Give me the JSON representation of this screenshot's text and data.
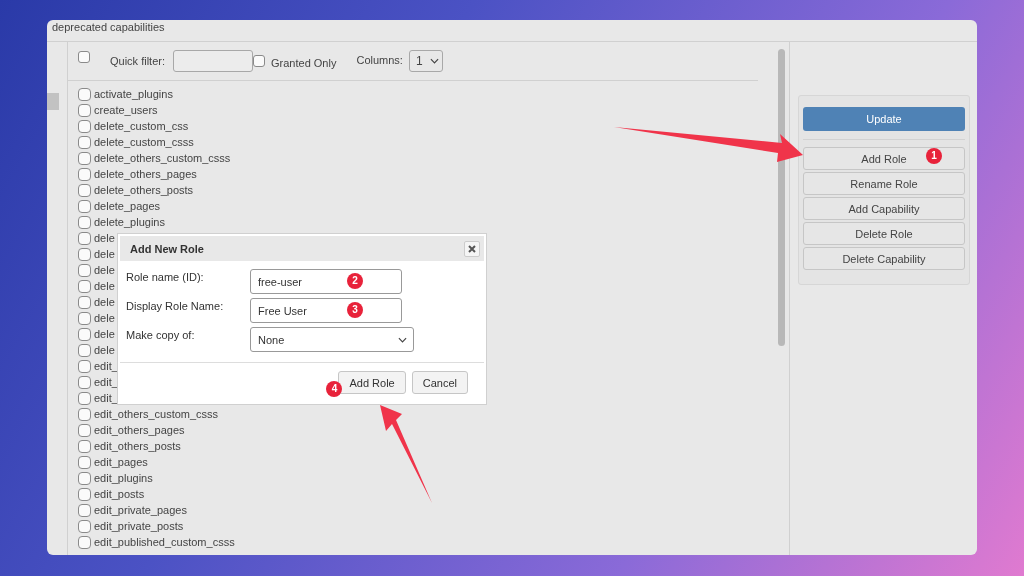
{
  "window": {
    "title": "deprecated capabilities"
  },
  "toolbar": {
    "select_all": {
      "checked": false
    },
    "quick_filter": {
      "label": "Quick filter:"
    },
    "granted_only": {
      "label": "Granted Only",
      "checked": false
    },
    "columns": {
      "label": "Columns:",
      "value": "1"
    }
  },
  "capabilities": [
    {
      "name": "activate_plugins",
      "checked": false
    },
    {
      "name": "create_users",
      "checked": false
    },
    {
      "name": "delete_custom_css",
      "checked": false
    },
    {
      "name": "delete_custom_csss",
      "checked": false
    },
    {
      "name": "delete_others_custom_csss",
      "checked": false
    },
    {
      "name": "delete_others_pages",
      "checked": false
    },
    {
      "name": "delete_others_posts",
      "checked": false
    },
    {
      "name": "delete_pages",
      "checked": false
    },
    {
      "name": "delete_plugins",
      "checked": false
    },
    {
      "name": "dele",
      "checked": false
    },
    {
      "name": "dele",
      "checked": false
    },
    {
      "name": "dele",
      "checked": false
    },
    {
      "name": "dele",
      "checked": false
    },
    {
      "name": "dele",
      "checked": false
    },
    {
      "name": "dele",
      "checked": false
    },
    {
      "name": "dele",
      "checked": false
    },
    {
      "name": "dele",
      "checked": false
    },
    {
      "name": "edit_",
      "checked": false
    },
    {
      "name": "edit_",
      "checked": false
    },
    {
      "name": "edit_",
      "checked": false
    },
    {
      "name": "edit_others_custom_csss",
      "checked": false
    },
    {
      "name": "edit_others_pages",
      "checked": false
    },
    {
      "name": "edit_others_posts",
      "checked": false
    },
    {
      "name": "edit_pages",
      "checked": false
    },
    {
      "name": "edit_plugins",
      "checked": false
    },
    {
      "name": "edit_posts",
      "checked": false
    },
    {
      "name": "edit_private_pages",
      "checked": false
    },
    {
      "name": "edit_private_posts",
      "checked": false
    },
    {
      "name": "edit_published_custom_csss",
      "checked": false
    }
  ],
  "actions": {
    "primary": "Update",
    "buttons": [
      {
        "label": "Add Role",
        "badge": "1"
      },
      {
        "label": "Rename Role"
      },
      {
        "label": "Add Capability"
      },
      {
        "label": "Delete Role"
      },
      {
        "label": "Delete Capability"
      }
    ]
  },
  "dialog": {
    "title": "Add New Role",
    "fields": [
      {
        "kind": "text",
        "label": "Role name (ID):",
        "value": "free-user",
        "badge": "2"
      },
      {
        "kind": "text",
        "label": "Display Role Name:",
        "value": "Free User",
        "badge": "3"
      },
      {
        "kind": "select",
        "label": "Make copy of:",
        "value": "None"
      }
    ],
    "buttons": [
      {
        "label": "Add Role",
        "badge": "4"
      },
      {
        "label": "Cancel"
      }
    ]
  }
}
